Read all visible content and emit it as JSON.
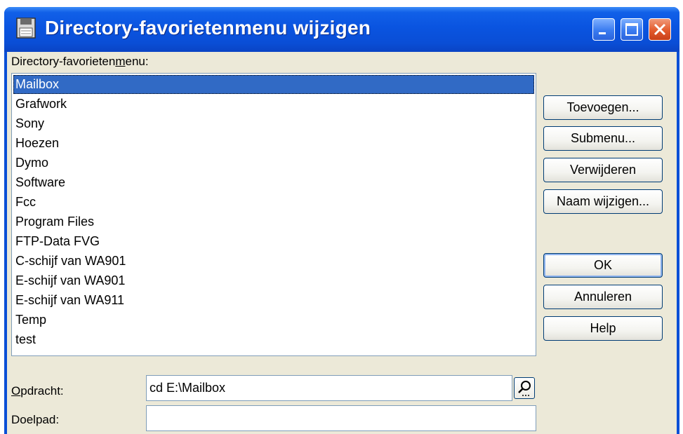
{
  "window": {
    "title": "Directory-favorietenmenu wijzigen"
  },
  "list": {
    "label_pre": "Directory-favorieten",
    "label_accel": "m",
    "label_post": "enu:",
    "items": [
      "Mailbox",
      "Grafwork",
      "Sony",
      "Hoezen",
      "Dymo",
      "Software",
      "Fcc",
      "Program Files",
      "FTP-Data FVG",
      "C-schijf van WA901",
      "E-schijf van WA901",
      "E-schijf van WA911",
      "Temp",
      "test"
    ],
    "selected_index": 0
  },
  "buttons": {
    "add": "Toevoegen...",
    "submenu": "Submenu...",
    "remove": "Verwijderen",
    "rename": "Naam wijzigen...",
    "ok": "OK",
    "cancel": "Annuleren",
    "help": "Help"
  },
  "command": {
    "label_accel": "O",
    "label_rest": "pdracht:",
    "value": "cd E:\\Mailbox"
  },
  "target": {
    "label": "Doelpad:",
    "value": ""
  },
  "colors": {
    "titlebar": "#0a54e0",
    "selection": "#316ac5",
    "dialog_bg": "#ece9d8",
    "close_button": "#e35a2c"
  }
}
